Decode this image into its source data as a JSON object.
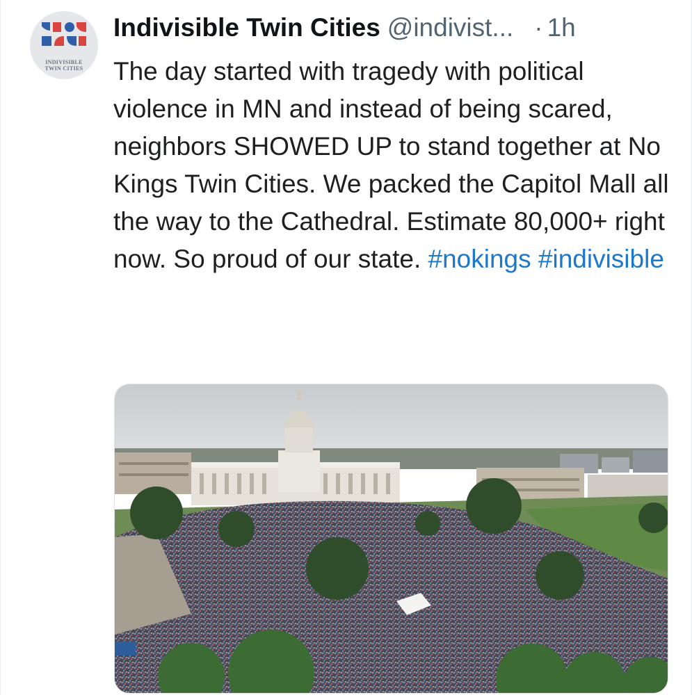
{
  "tweet": {
    "display_name": "Indivisible Twin Cities",
    "handle": "@indivist...",
    "dot": "·",
    "timestamp": "1h",
    "avatar": {
      "line1": "INDIVISIBLE",
      "line2": "TWIN CITIES",
      "colors": {
        "blue": "#2f5fa8",
        "red": "#d9453f",
        "bg": "#e5e7ea"
      }
    },
    "body": {
      "text": "The day started with tragedy with political violence in MN and instead of being scared, neighbors SHOWED UP to stand together at No Kings Twin Cities. We packed the Capitol Mall all the way to the Cathedral. Estimate 80,000+ right now. So proud of our state.",
      "hashtags": [
        "#nokings",
        "#indivisible"
      ]
    },
    "media": {
      "icon": "photo-image"
    }
  },
  "colors": {
    "link": "#1d78c9",
    "muted": "#536471",
    "text": "#0f1419"
  }
}
